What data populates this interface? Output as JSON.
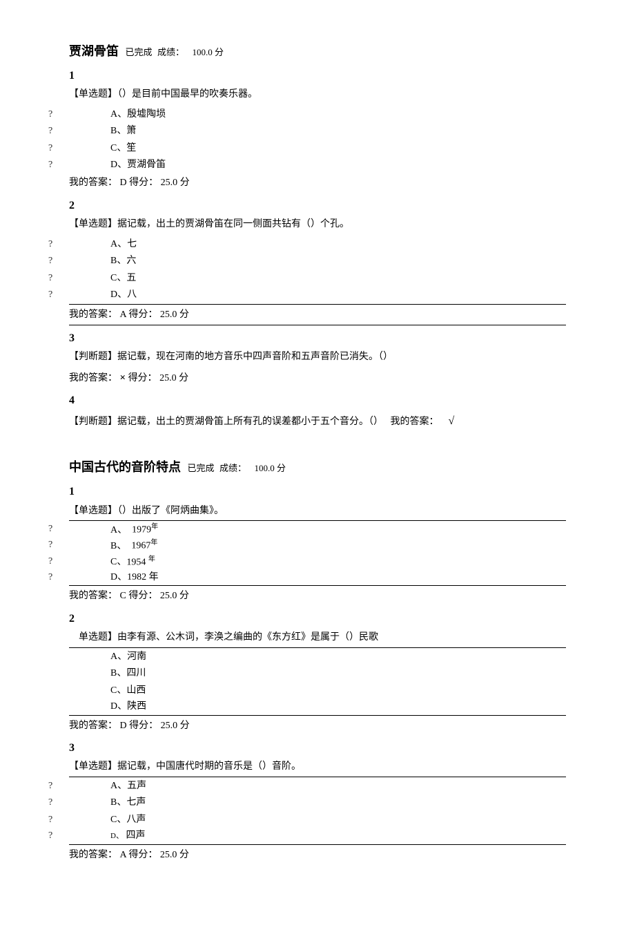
{
  "sections": [
    {
      "title": "贾湖骨笛",
      "status": "已完成",
      "score_label": "成绩：",
      "score": "100.0 分",
      "questions": [
        {
          "num": "1",
          "prompt": "【单选题】（）是目前中国最早的吹奏乐器。",
          "options": [
            {
              "bullet": "?",
              "letter": "A、",
              "text": "殷墟陶埙"
            },
            {
              "bullet": "?",
              "letter": "B、",
              "text": "箫"
            },
            {
              "bullet": "?",
              "letter": "C、",
              "text": "笙"
            },
            {
              "bullet": "?",
              "letter": "D、",
              "text": "贾湖骨笛"
            }
          ],
          "answer_prefix": "我的答案：",
          "answer_letter": "D",
          "answer_score_label": "得分：",
          "answer_score": "25.0 分"
        },
        {
          "num": "2",
          "prompt": "【单选题】据记载，出土的贾湖骨笛在同一侧面共钻有（）个孔。",
          "options": [
            {
              "bullet": "?",
              "letter": "A、",
              "text": "七"
            },
            {
              "bullet": "?",
              "letter": "B、",
              "text": "六"
            },
            {
              "bullet": "?",
              "letter": "C、",
              "text": "五"
            },
            {
              "bullet": "?",
              "letter": "D、",
              "text": "八"
            }
          ],
          "answer_prefix": "我的答案：",
          "answer_letter": "A",
          "answer_score_label": "得分：",
          "answer_score": "25.0 分"
        },
        {
          "num": "3",
          "prompt": "【判断题】据记载，现在河南的地方音乐中四声音阶和五声音阶已消失。（）",
          "answer_prefix": "我的答案：",
          "answer_mark": "×",
          "answer_score_label": "得分：",
          "answer_score": "25.0 分"
        },
        {
          "num": "4",
          "prompt": "【判断题】据记载，出土的贾湖骨笛上所有孔的误差都小于五个音分。（）",
          "inline_answer_prefix": "我的答案：",
          "inline_answer_mark": "√"
        }
      ]
    },
    {
      "title": "中国古代的音阶特点",
      "status": "已完成",
      "score_label": "成绩：",
      "score": "100.0 分",
      "questions": [
        {
          "num": "1",
          "prompt": "【单选题】（）出版了《阿炳曲集》。",
          "options": [
            {
              "bullet": "?",
              "letter": "A、",
              "text": "1979",
              "suffix": "年"
            },
            {
              "bullet": "?",
              "letter": "B、",
              "text": "1967",
              "suffix": "年"
            },
            {
              "bullet": "?",
              "letter": "C、",
              "text": "1954",
              "suffix": "年"
            },
            {
              "bullet": "?",
              "letter": "D、",
              "text": "1982",
              "suffix": "年"
            }
          ],
          "answer_prefix": "我的答案：",
          "answer_letter": "C",
          "answer_score_label": "得分：",
          "answer_score": "25.0 分"
        },
        {
          "num": "2",
          "prompt": "单选题】由李有源、公木词，李涣之编曲的《东方红》是属于（）民歌",
          "options": [
            {
              "letter": "A、",
              "text": "河南"
            },
            {
              "letter": "B、",
              "text": "四川"
            },
            {
              "letter": "C、",
              "text": "山西"
            },
            {
              "letter": "D、",
              "text": "陕西"
            }
          ],
          "answer_prefix": "我的答案：",
          "answer_letter": "D",
          "answer_score_label": "得分：",
          "answer_score": "25.0 分"
        },
        {
          "num": "3",
          "prompt": "【单选题】据记载，中国唐代时期的音乐是（）音阶。",
          "options": [
            {
              "bullet": "?",
              "letter": "A、",
              "text": "五声"
            },
            {
              "bullet": "?",
              "letter": "B、",
              "text": "七声"
            },
            {
              "bullet": "?",
              "letter": "C、",
              "text": "八声"
            },
            {
              "bullet": "?",
              "letter": "D、",
              "text": "四声"
            }
          ],
          "answer_prefix": "我的答案：",
          "answer_letter": "A",
          "answer_score_label": "得分：",
          "answer_score": "25.0 分"
        }
      ]
    }
  ]
}
